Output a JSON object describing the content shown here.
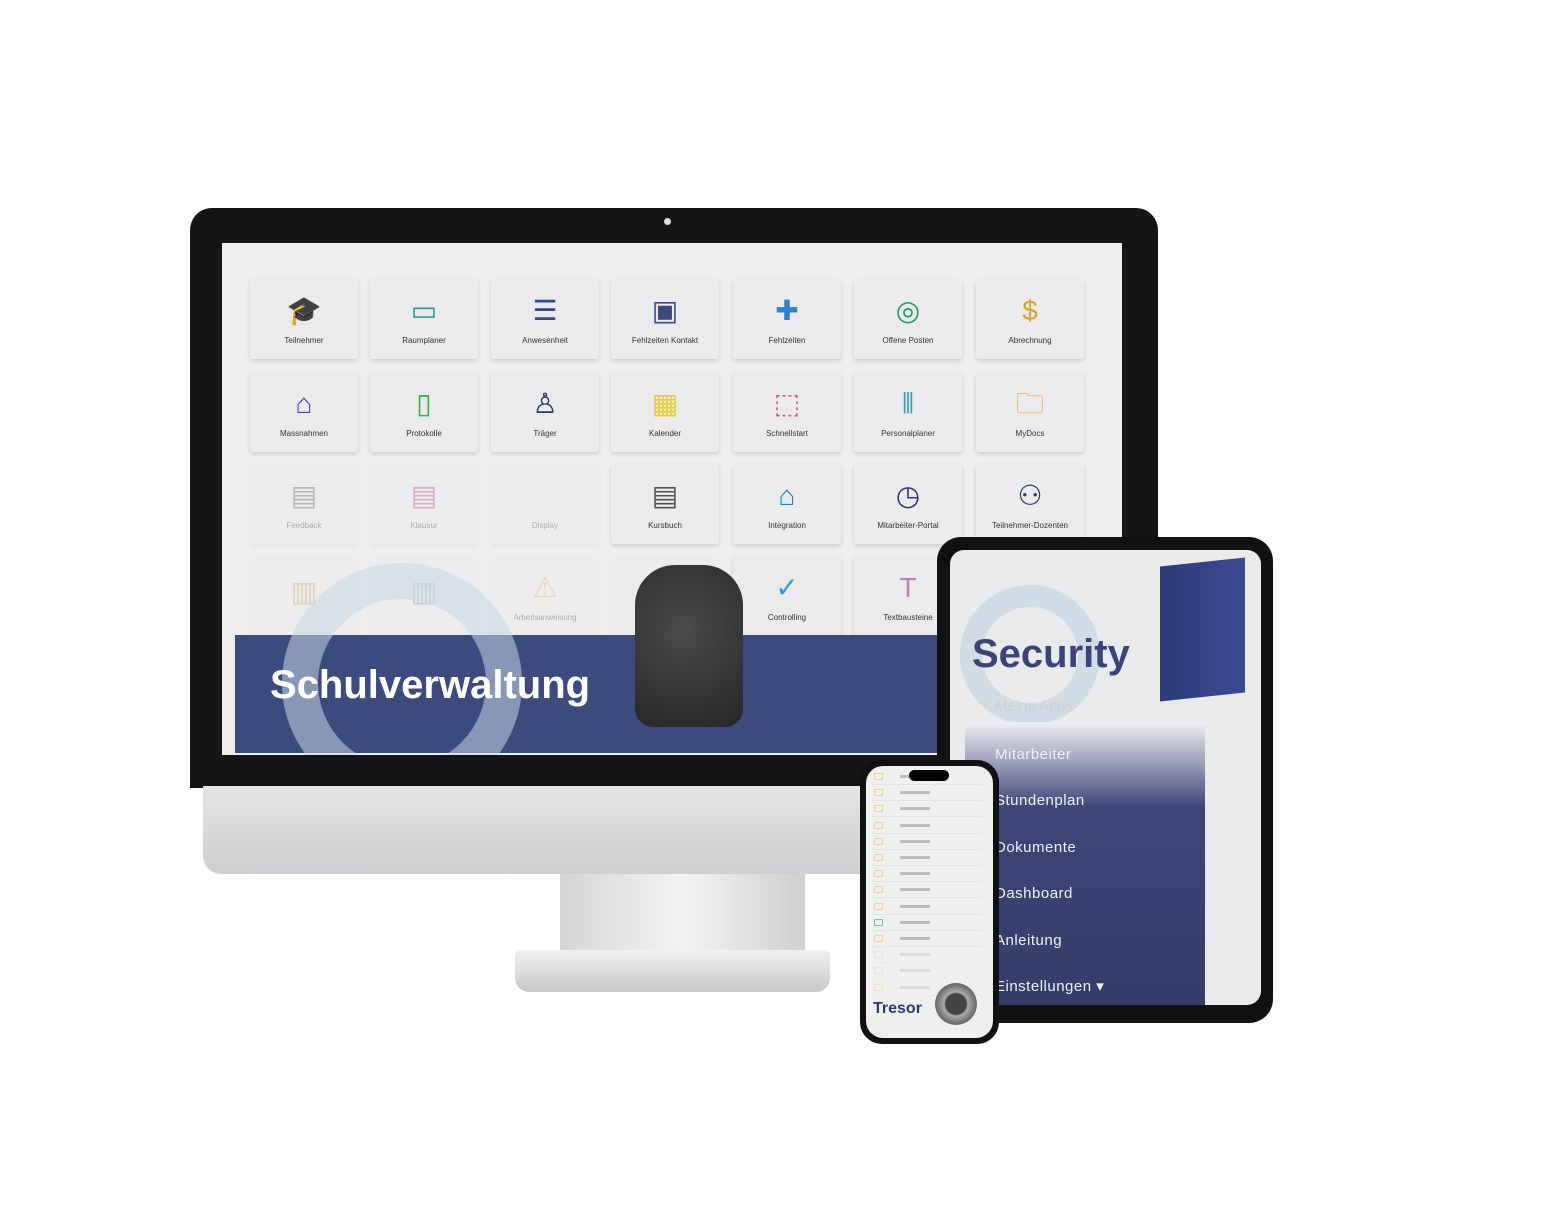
{
  "monitor": {
    "tiles": [
      {
        "label": "Teilnehmer",
        "icon": "graduate-icon",
        "glyph": "🎓",
        "color": "#f0a030"
      },
      {
        "label": "Raumplaner",
        "icon": "whiteboard-icon",
        "glyph": "▭",
        "color": "#20a090"
      },
      {
        "label": "Anwesenheit",
        "icon": "list-icon",
        "glyph": "☰",
        "color": "#3a4a80"
      },
      {
        "label": "Fehlzeiten Kontakt",
        "icon": "contact-book-icon",
        "glyph": "▣",
        "color": "#3a4a80"
      },
      {
        "label": "Fehlzeiten",
        "icon": "medical-copy-icon",
        "glyph": "✚",
        "color": "#3080d0"
      },
      {
        "label": "Offene Posten",
        "icon": "coins-icon",
        "glyph": "◎",
        "color": "#20a060"
      },
      {
        "label": "Abrechnung",
        "icon": "payment-hand-icon",
        "glyph": "$",
        "color": "#e0a020"
      },
      {
        "label": "Massnahmen",
        "icon": "home-icon",
        "glyph": "⌂",
        "color": "#4040e0"
      },
      {
        "label": "Protokolle",
        "icon": "document-icon",
        "glyph": "▯",
        "color": "#30b040"
      },
      {
        "label": "Träger",
        "icon": "worker-icon",
        "glyph": "♙",
        "color": "#2a3a70"
      },
      {
        "label": "Kalender",
        "icon": "calendar-icon",
        "glyph": "▦",
        "color": "#e8d020"
      },
      {
        "label": "Schnellstart",
        "icon": "frame-icon",
        "glyph": "⬚",
        "color": "#e05080"
      },
      {
        "label": "Personalplaner",
        "icon": "staff-planner-icon",
        "glyph": "⫴",
        "color": "#30a0c0"
      },
      {
        "label": "MyDocs",
        "icon": "folder-icon",
        "glyph": "🗀",
        "color": "#f0a040"
      },
      {
        "label": "Feedback",
        "icon": "book-icon",
        "glyph": "▤",
        "color": "#555",
        "faded": true
      },
      {
        "label": "Klausur",
        "icon": "book-icon",
        "glyph": "▤",
        "color": "#c03070",
        "faded": true
      },
      {
        "label": "Display",
        "icon": "display-icon",
        "glyph": "",
        "color": "#999",
        "faded": true
      },
      {
        "label": "Kursbuch",
        "icon": "book-icon",
        "glyph": "▤",
        "color": "#555"
      },
      {
        "label": "Integration",
        "icon": "integration-icon",
        "glyph": "⌂",
        "color": "#2080c0"
      },
      {
        "label": "Mitarbeiter-Portal",
        "icon": "clock-icon",
        "glyph": "◷",
        "color": "#2a3a70"
      },
      {
        "label": "Teilnehmer-Dozenten",
        "icon": "group-icon",
        "glyph": "⚇",
        "color": "#2a3a70"
      },
      {
        "label": "",
        "icon": "building-icon",
        "glyph": "▥",
        "color": "#c0a050",
        "faded": true
      },
      {
        "label": "",
        "icon": "building-icon",
        "glyph": "▥",
        "color": "#70a090",
        "faded": true
      },
      {
        "label": "Arbeitsanweisung",
        "icon": "warning-icon",
        "glyph": "⚠",
        "color": "#f0a040",
        "faded": true
      },
      {
        "label": "",
        "icon": "blank-icon",
        "glyph": "",
        "color": "#999",
        "faded": true
      },
      {
        "label": "Controlling",
        "icon": "double-check-icon",
        "glyph": "✓",
        "color": "#30a0d0"
      },
      {
        "label": "Textbausteine",
        "icon": "text-icon",
        "glyph": "T",
        "color": "#c080b0"
      }
    ],
    "banner_title": "Schulverwaltung",
    "banner_color": "#3d4a7e"
  },
  "tablet": {
    "title": "Security",
    "search_placeholder": "Meine Apps",
    "menu": [
      "Mitarbeiter",
      "Stundenplan",
      "Dokumente",
      "Dashboard",
      "Anleitung",
      "Einstellungen ▾"
    ]
  },
  "phone": {
    "title": "Tresor"
  }
}
